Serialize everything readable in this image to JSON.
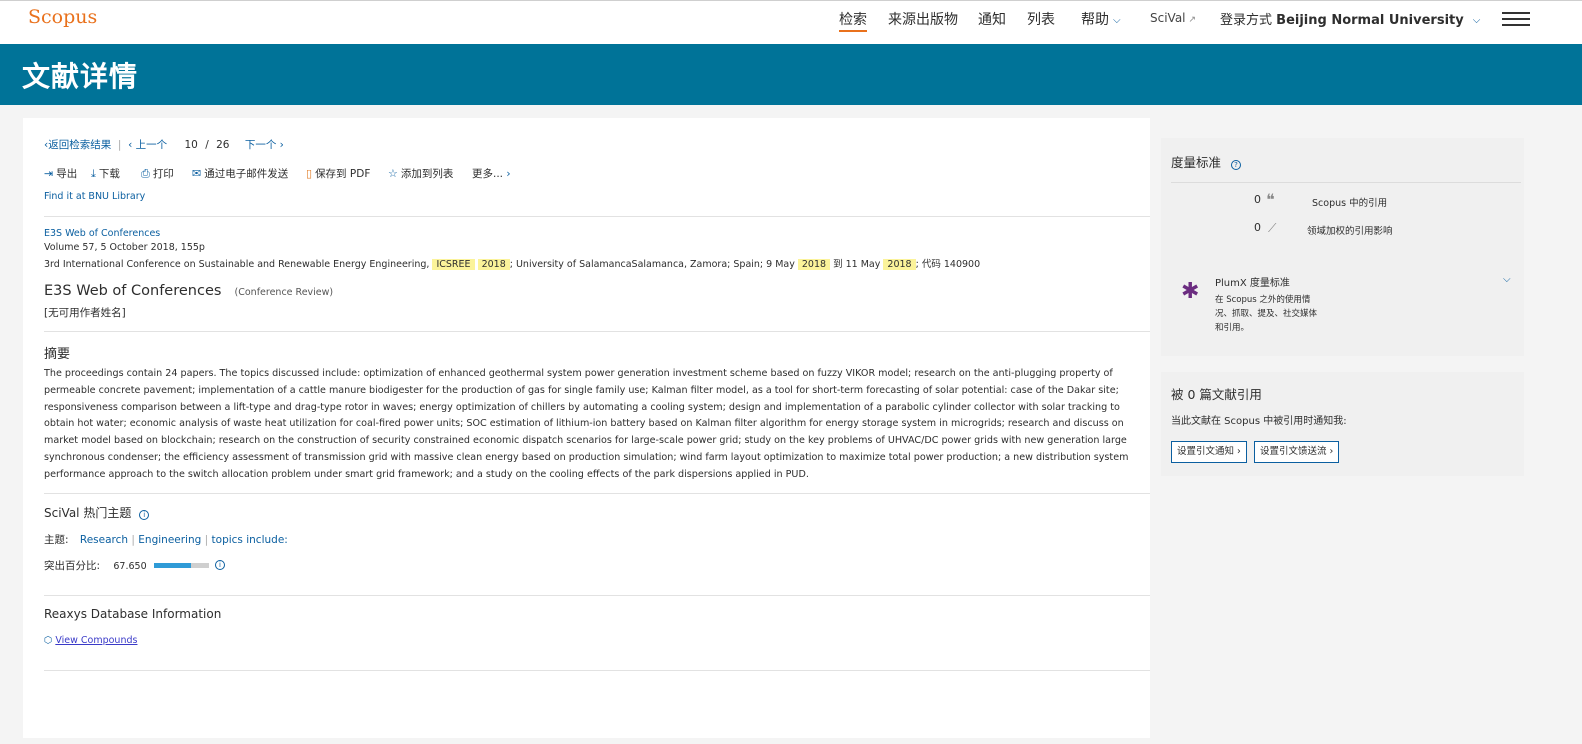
{
  "nav": {
    "logo": "Scopus",
    "search": "检索",
    "sources": "来源出版物",
    "alerts": "通知",
    "lists": "列表",
    "help": "帮助",
    "scival": "SciVal",
    "login_prefix": "登录方式",
    "institution": "Beijing Normal University"
  },
  "banner": {
    "title": "文献详情"
  },
  "pager": {
    "back": "返回检索结果",
    "prev": "上一个",
    "current": "10",
    "slash": "/",
    "total": "26",
    "next": "下一个"
  },
  "toolbar": {
    "export": "导出",
    "download": "下载",
    "print": "打印",
    "email": "通过电子邮件发送",
    "save_pdf": "保存到 PDF",
    "add_list": "添加到列表",
    "more": "更多..."
  },
  "find_it": "Find it at BNU Library",
  "source": {
    "journal_link": "E3S Web of Conferences",
    "volume": "Volume 57, 5 October 2018, 155p",
    "conf_name": "3rd International Conference on Sustainable and Renewable Energy Engineering,",
    "conf_acronym": "ICSREE",
    "year": "2018",
    "conf_location": "; University of SalamancaSalamanca, Zamora; Spain; 9 May",
    "to": "到 11 May",
    "code": "; 代码 140900"
  },
  "document": {
    "title": "E3S Web of Conferences",
    "type": "(Conference Review)",
    "authors": "[无可用作者姓名]"
  },
  "abstract": {
    "heading": "摘要",
    "text": "The proceedings contain 24 papers. The topics discussed include: optimization of enhanced geothermal system power generation investment scheme based on fuzzy VIKOR model; research on the anti-plugging property of permeable concrete pavement; implementation of a cattle manure biodigester for the production of gas for single family use; Kalman filter model, as a tool for short-term forecasting of solar potential: case of the Dakar site; responsiveness comparison between a lift-type and drag-type rotor in waves; energy optimization of chillers by automating a cooling system; design and implementation of a parabolic cylinder collector with solar tracking to obtain hot water; economic analysis of waste heat utilization for coal-fired power units; SOC estimation of lithium-ion battery based on Kalman filter algorithm for energy storage system in microgrids; research and discuss on market model based on blockchain; research on the construction of security constrained economic dispatch scenarios for large-scale power grid; study on the key problems of UHVAC/DC power grids with new generation large synchronous condenser; the efficiency assessment of transmission grid with massive clean energy based on production simulation; wind farm layout optimization to maximize total power production; a new distribution system performance approach to the switch allocation problem under smart grid framework; and a study on the cooling effects of the park dispersions applied in PUD."
  },
  "scival_topics": {
    "heading": "SciVal 热门主题",
    "topic_label": "主题:",
    "topics": [
      "Research",
      "Engineering",
      "topics include:"
    ],
    "prominence_label": "突出百分比:",
    "prominence_value": "67.650",
    "prominence_fraction": 0.6765
  },
  "reaxys": {
    "heading": "Reaxys Database Information",
    "link": "View Compounds"
  },
  "metrics": {
    "heading": "度量标准",
    "citations_count": "0",
    "citations_label": "Scopus 中的引用",
    "fwci_count": "0",
    "fwci_label": "领域加权的引用影响",
    "plumx_title": "PlumX 度量标准",
    "plumx_line1": "在 Scopus 之外的使用情",
    "plumx_line2": "况、抓取、提及、社交媒体",
    "plumx_line3": "和引用。"
  },
  "cited_by": {
    "heading": "被 0 篇文献引用",
    "notify_text": "当此文献在 Scopus 中被引用时通知我:",
    "alert_button": "设置引文通知",
    "feed_button": "设置引文馈送流"
  }
}
